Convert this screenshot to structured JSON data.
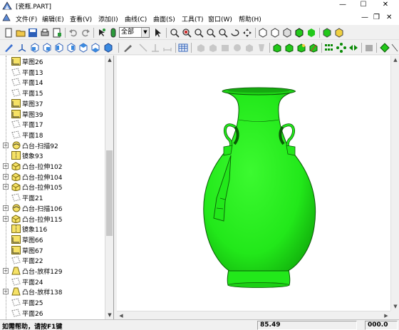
{
  "window": {
    "title": "[瓷瓶.PART]",
    "minimize": "—",
    "maximize": "☐",
    "close": "✕"
  },
  "menu": {
    "items": [
      "文件(F)",
      "编辑(E)",
      "查看(V)",
      "添加(I)",
      "曲线(C)",
      "曲面(S)",
      "工具(T)",
      "窗口(W)",
      "帮助(H)"
    ],
    "mdi_minimize": "—",
    "mdi_restore": "❐",
    "mdi_close": "✕"
  },
  "toolbar": {
    "filter_value": "全部"
  },
  "tree": {
    "items": [
      {
        "label": "草图26",
        "icon": "sketch-icon",
        "expander": ""
      },
      {
        "label": "平面13",
        "icon": "plane-icon",
        "expander": ""
      },
      {
        "label": "平面14",
        "icon": "plane-icon",
        "expander": ""
      },
      {
        "label": "平面15",
        "icon": "plane-icon",
        "expander": ""
      },
      {
        "label": "草图37",
        "icon": "sketch-icon",
        "expander": ""
      },
      {
        "label": "草图39",
        "icon": "sketch-icon",
        "expander": ""
      },
      {
        "label": "平面17",
        "icon": "plane-icon",
        "expander": ""
      },
      {
        "label": "平面18",
        "icon": "plane-icon",
        "expander": ""
      },
      {
        "label": "凸台-扫描92",
        "icon": "sweep-boss-icon",
        "expander": "+"
      },
      {
        "label": "镜象93",
        "icon": "mirror-icon",
        "expander": ""
      },
      {
        "label": "凸台-拉伸102",
        "icon": "extrude-boss-icon",
        "expander": "+"
      },
      {
        "label": "凸台-拉伸104",
        "icon": "extrude-boss-icon",
        "expander": "+"
      },
      {
        "label": "凸台-拉伸105",
        "icon": "extrude-boss-icon",
        "expander": "+"
      },
      {
        "label": "平面21",
        "icon": "plane-icon",
        "expander": ""
      },
      {
        "label": "凸台-扫描106",
        "icon": "sweep-boss-icon",
        "expander": "+"
      },
      {
        "label": "凸台-拉伸115",
        "icon": "extrude-boss-icon",
        "expander": "+"
      },
      {
        "label": "镜象116",
        "icon": "mirror-icon",
        "expander": ""
      },
      {
        "label": "草图66",
        "icon": "sketch-icon",
        "expander": ""
      },
      {
        "label": "草图67",
        "icon": "sketch-icon",
        "expander": ""
      },
      {
        "label": "平面22",
        "icon": "plane-icon",
        "expander": ""
      },
      {
        "label": "凸台-放样129",
        "icon": "loft-boss-icon",
        "expander": "+"
      },
      {
        "label": "平面24",
        "icon": "plane-icon",
        "expander": ""
      },
      {
        "label": "凸台-放样138",
        "icon": "loft-boss-icon",
        "expander": "+"
      },
      {
        "label": "平面25",
        "icon": "plane-icon",
        "expander": ""
      },
      {
        "label": "平面26",
        "icon": "plane-icon",
        "expander": ""
      }
    ]
  },
  "status": {
    "help": "如需帮助，请按F1键",
    "coord": "85.49",
    "value": "000.0"
  },
  "colors": {
    "model": "#22e81a",
    "model_edge": "#0a5a06"
  }
}
